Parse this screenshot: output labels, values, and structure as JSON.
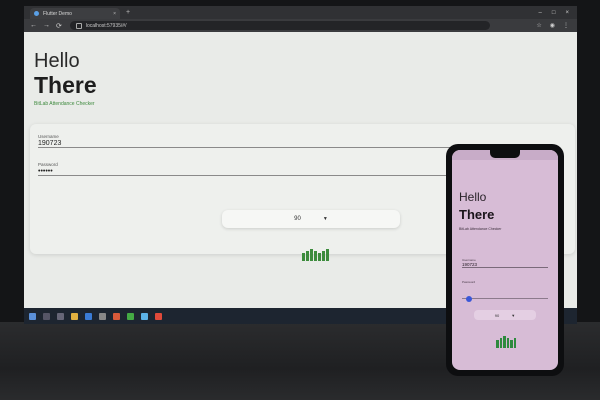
{
  "browser": {
    "tab_title": "Flutter Demo",
    "url": "localhost:57935/#/",
    "tab_close": "×",
    "new_tab": "+",
    "window_controls": [
      "–",
      "□",
      "×"
    ],
    "nav": [
      "←",
      "→",
      "⟳"
    ],
    "toolbar_icons": [
      "☆",
      "◉",
      "⋮"
    ]
  },
  "web_app": {
    "greeting": "Hello",
    "title": "There",
    "subtitle": "BitLab Attendance Checker",
    "username": {
      "label": "Username",
      "value": "190723"
    },
    "password": {
      "label": "Password",
      "value": "••••••"
    },
    "dropdown": {
      "value": "90",
      "arrow": "▼"
    }
  },
  "phone_app": {
    "greeting": "Hello",
    "title": "There",
    "subtitle": "BitLab Attendance Checker",
    "username": {
      "label": "Username",
      "value": "190723"
    },
    "password": {
      "label": "Password"
    },
    "slider_level": 0.1,
    "dropdown": {
      "value": "90",
      "arrow": "▼"
    }
  },
  "colors": {
    "accent_green": "#3d8c3d",
    "slider_blue": "#3a57d8",
    "phone_background": "#d7bcd6"
  }
}
